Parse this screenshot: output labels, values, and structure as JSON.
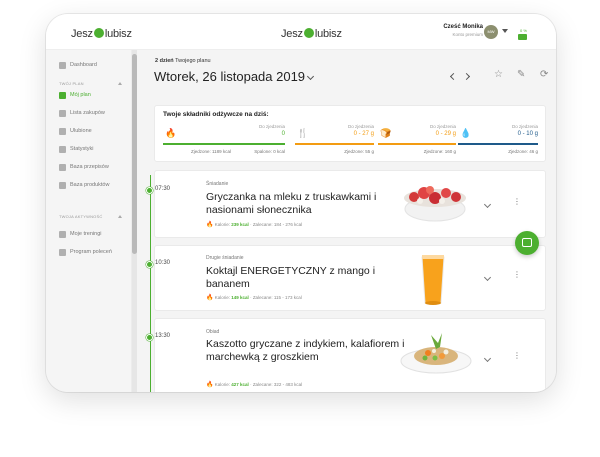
{
  "header": {
    "logo_left": [
      "Jesz",
      "lubisz"
    ],
    "logo_center": [
      "Jesz",
      "lubisz"
    ],
    "user_name": "Cześć Monika",
    "user_sub": "Konto premium",
    "avatar_initials": "MW",
    "notif_count": "0 %",
    "accent_color": "#4caf30"
  },
  "sidebar": {
    "items": [
      {
        "label": "Dashboard",
        "icon": "home-icon"
      },
      {
        "label": "Mój plan",
        "icon": "plan-icon"
      },
      {
        "label": "Lista zakupów",
        "icon": "list-icon"
      },
      {
        "label": "Ulubione",
        "icon": "star-icon"
      },
      {
        "label": "Statystyki",
        "icon": "chart-icon"
      },
      {
        "label": "Baza przepisów",
        "icon": "recipes-icon"
      },
      {
        "label": "Baza produktów",
        "icon": "products-icon"
      },
      {
        "label": "Moje treningi",
        "icon": "training-icon"
      },
      {
        "label": "Program poleceń",
        "icon": "referral-icon"
      }
    ],
    "section_plan": "TWÓJ PLAN",
    "section_activity": "TWOJA AKTYWNOŚĆ"
  },
  "main": {
    "plan_day_bold": "2 dzień",
    "plan_day_rest": " Twojego planu",
    "title": "Wtorek, 26 listopada 2019",
    "tools": [
      "☆",
      "✎",
      "⟳",
      "⎙"
    ]
  },
  "nutrients": {
    "title": "Twoje składniki odżywcze na dziś:",
    "cols": [
      {
        "label": "Do zjedzenia",
        "value": "0",
        "sub_left": "Zjedzone: 1189 kcal",
        "sub_right": "Spalone: 0 kcal",
        "color": "#4caf30",
        "icon": "flame-icon",
        "glyph": "🔥",
        "fill": 1.0
      },
      {
        "label": "Do zjedzenia",
        "value": "0 - 27 g",
        "sub": "Zjedzone: 55 g",
        "color": "#f39c12",
        "icon": "fork-icon",
        "glyph": "🍴",
        "fill": 1.0
      },
      {
        "label": "Do zjedzenia",
        "value": "0 - 29 g",
        "sub": "Zjedzone: 160 g",
        "color": "#f39c12",
        "icon": "bread-icon",
        "glyph": "🍞",
        "fill": 1.0
      },
      {
        "label": "Do zjedzenia",
        "value": "0 - 10 g",
        "sub": "Zjedzone: 46 g",
        "color": "#1e5a8a",
        "icon": "drop-icon",
        "glyph": "💧",
        "fill": 1.0
      }
    ]
  },
  "meals": [
    {
      "time": "07:30",
      "type": "Śniadanie",
      "title": "Gryczanka na mleku z truskawkami i nasionami słonecznika",
      "kcal_label": "Kalorie:",
      "kcal": "239 kcal",
      "rec": "Zalecane: 184 - 276 kcal",
      "image": "strawberry-bowl"
    },
    {
      "time": "10:30",
      "type": "Drugie śniadanie",
      "title": "Koktajl ENERGETYCZNY z mango i bananem",
      "kcal_label": "Kalorie:",
      "kcal": "149 kcal",
      "rec": "Zalecane: 115 - 173 kcal",
      "image": "mango-drink"
    },
    {
      "time": "13:30",
      "type": "Obiad",
      "title": "Kaszotto gryczane z indykiem, kalafiorem i marchewką z groszkiem",
      "kcal_label": "Kalorie:",
      "kcal": "427 kcal",
      "rec": "Zalecane: 322 - 483 kcal",
      "image": "kaszotto-plate"
    }
  ]
}
